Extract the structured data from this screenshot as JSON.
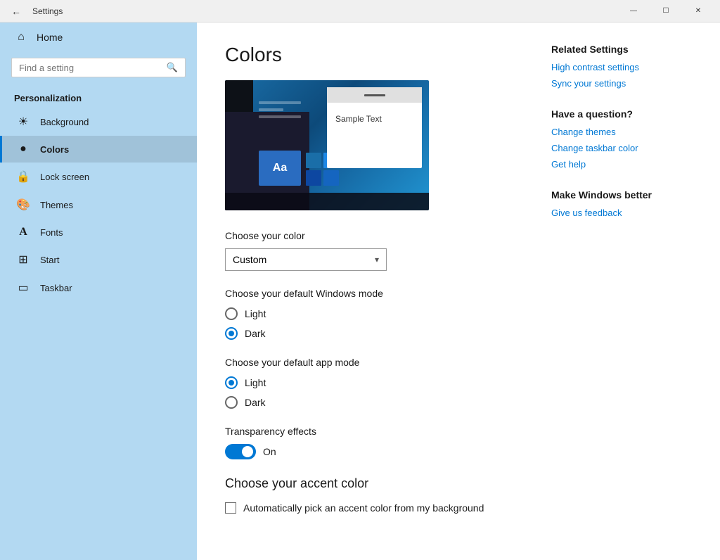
{
  "titlebar": {
    "title": "Settings",
    "minimize": "—",
    "maximize": "☐",
    "close": "✕"
  },
  "sidebar": {
    "search_placeholder": "Find a setting",
    "section_title": "Personalization",
    "items": [
      {
        "id": "home",
        "label": "Home",
        "icon": "⌂"
      },
      {
        "id": "background",
        "label": "Background",
        "icon": "🖼"
      },
      {
        "id": "colors",
        "label": "Colors",
        "icon": "🎨"
      },
      {
        "id": "lock-screen",
        "label": "Lock screen",
        "icon": "🔒"
      },
      {
        "id": "themes",
        "label": "Themes",
        "icon": "🖌"
      },
      {
        "id": "fonts",
        "label": "Fonts",
        "icon": "A"
      },
      {
        "id": "start",
        "label": "Start",
        "icon": "⊞"
      },
      {
        "id": "taskbar",
        "label": "Taskbar",
        "icon": "▭"
      }
    ]
  },
  "main": {
    "page_title": "Colors",
    "choose_color_label": "Choose your color",
    "color_dropdown_value": "Custom",
    "color_dropdown_arrow": "▾",
    "windows_mode_label": "Choose your default Windows mode",
    "windows_mode_options": [
      {
        "id": "light",
        "label": "Light",
        "selected": false
      },
      {
        "id": "dark",
        "label": "Dark",
        "selected": true
      }
    ],
    "app_mode_label": "Choose your default app mode",
    "app_mode_options": [
      {
        "id": "light",
        "label": "Light",
        "selected": true
      },
      {
        "id": "dark",
        "label": "Dark",
        "selected": false
      }
    ],
    "transparency_label": "Transparency effects",
    "transparency_state": "On",
    "accent_title": "Choose your accent color",
    "accent_checkbox_label": "Automatically pick an accent color from my background",
    "preview": {
      "sample_text": "Sample Text",
      "aa_text": "Aa"
    }
  },
  "related": {
    "related_title": "Related Settings",
    "high_contrast_label": "High contrast settings",
    "sync_settings_label": "Sync your settings",
    "question_title": "Have a question?",
    "change_themes_label": "Change themes",
    "change_taskbar_label": "Change taskbar color",
    "get_help_label": "Get help",
    "make_better_title": "Make Windows better",
    "feedback_label": "Give us feedback"
  }
}
